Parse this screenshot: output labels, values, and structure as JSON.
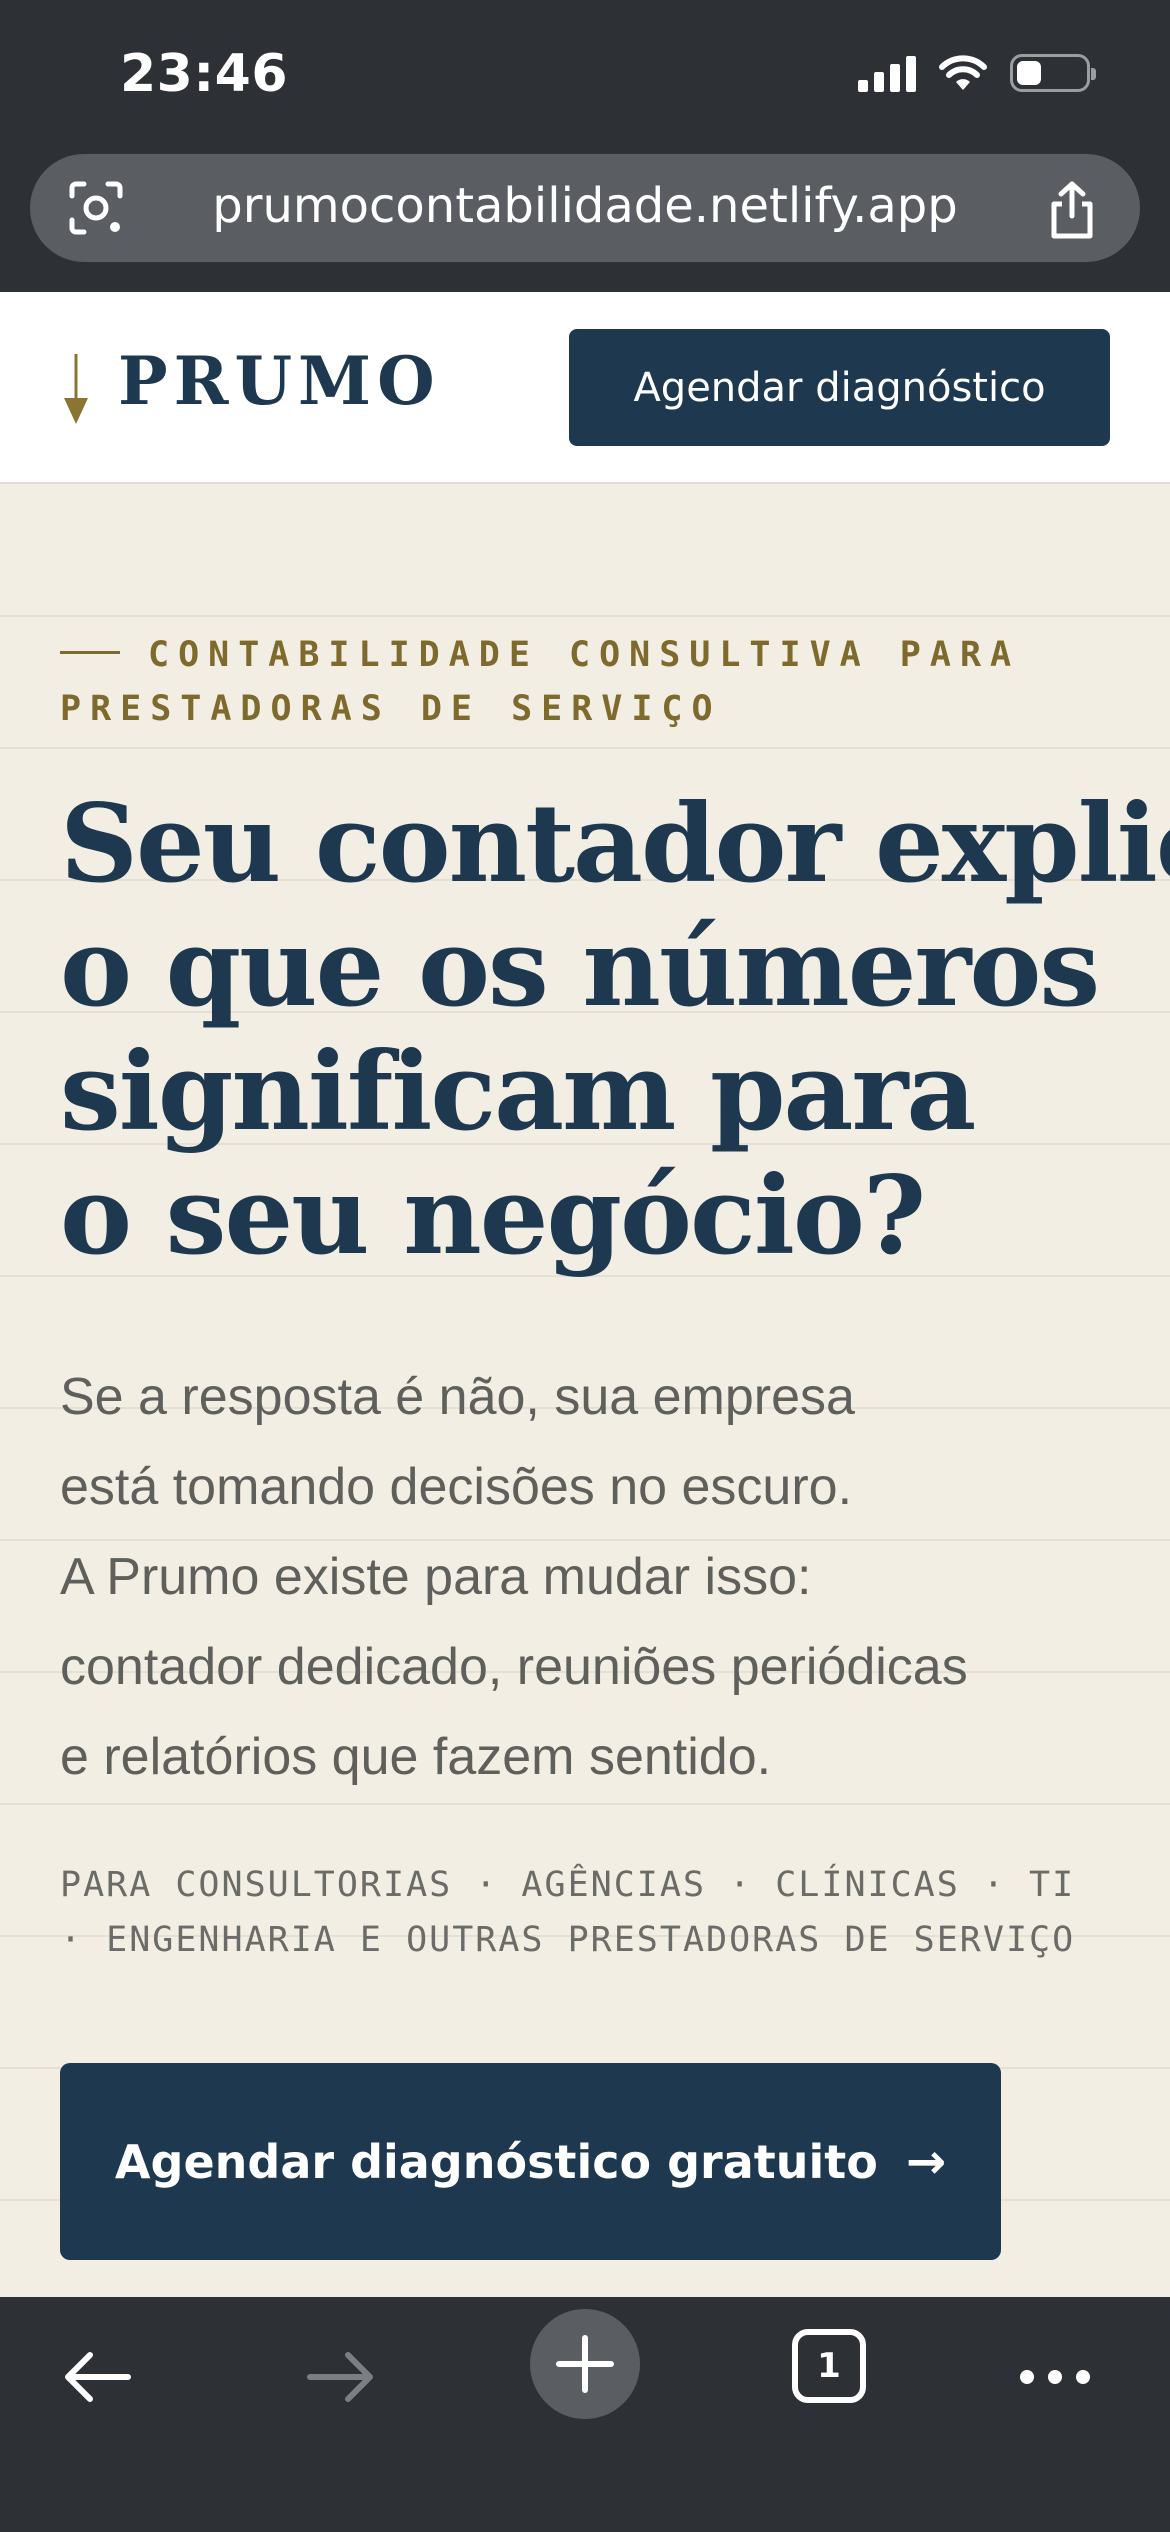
{
  "status_bar": {
    "time": "23:46"
  },
  "browser": {
    "url": "prumocontabilidade.netlify.app",
    "open_tabs": "1"
  },
  "header": {
    "logo": "PRUMO",
    "cta_label": "Agendar diagnóstico"
  },
  "hero": {
    "eyebrow": "CONTABILIDADE CONSULTIVA PARA PRESTADORAS DE SERVIÇO",
    "headline_lines": [
      "Seu contador explica",
      "o que os números",
      "significam para",
      "o seu negócio?"
    ],
    "lead_lines": [
      "Se a resposta é não, sua empresa",
      "está tomando decisões no escuro.",
      "A Prumo existe para mudar isso:",
      "contador dedicado, reuniões periódicas",
      "e relatórios que fazem sentido."
    ],
    "audience_lines": [
      "PARA CONSULTORIAS · AGÊNCIAS · CLÍNICAS · TI",
      "· ENGENHARIA E OUTRAS PRESTADORAS DE SERVIÇO"
    ],
    "cta_label": "Agendar diagnóstico gratuito",
    "cta_arrow": "→"
  },
  "colors": {
    "navy": "#1e3850",
    "gold": "#7f6a2e",
    "cream": "#f3eee4",
    "chrome": "#2d3034"
  }
}
